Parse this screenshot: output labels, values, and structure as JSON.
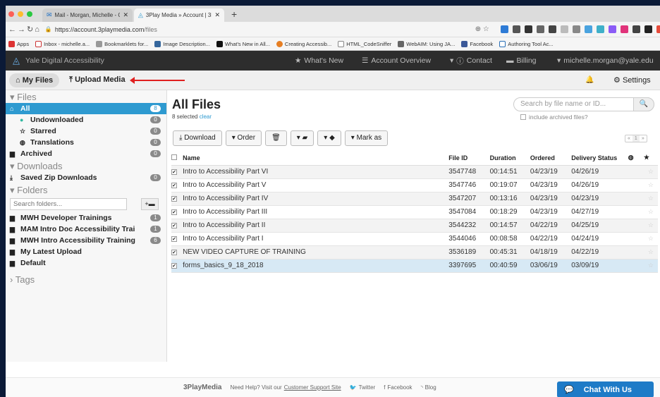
{
  "browser": {
    "tabs": [
      {
        "label": "Mail - Morgan, Michelle - Outlo",
        "icon": "outlook-icon"
      },
      {
        "label": "3Play Media » Account | 3Play",
        "icon": "3play-icon"
      }
    ],
    "new_tab": "+",
    "url_host": "https://account.3playmedia.com",
    "url_path": "/files",
    "bookmarks": [
      "Apps",
      "Inbox - michelle.a...",
      "Bookmarklets for...",
      "Image Description...",
      "What's New in All...",
      "Creating Accessib...",
      "HTML_CodeSniffer",
      "WebAIM: Using JA...",
      "Facebook",
      "Authoring Tool Ac..."
    ]
  },
  "app": {
    "brand": "Yale Digital Accessibility",
    "menu": {
      "whats_new": "What's New",
      "account_overview": "Account Overview",
      "contact": "Contact",
      "billing": "Billing",
      "user": "michelle.morgan@yale.edu"
    },
    "my_files": "My Files",
    "upload_media": "Upload Media",
    "settings": "Settings"
  },
  "sidebar": {
    "files_header": "Files",
    "all": {
      "label": "All",
      "count": "8"
    },
    "undownloaded": {
      "label": "Undownloaded",
      "count": "0"
    },
    "starred": {
      "label": "Starred",
      "count": "0"
    },
    "translations": {
      "label": "Translations",
      "count": "0"
    },
    "archived": {
      "label": "Archived",
      "count": "0"
    },
    "downloads_header": "Downloads",
    "saved_zip": {
      "label": "Saved Zip Downloads",
      "count": "0"
    },
    "folders_header": "Folders",
    "folder_search_placeholder": "Search folders...",
    "folders": [
      {
        "label": "MWH Developer Trainings",
        "count": "1"
      },
      {
        "label": "MAM Intro Doc Accessibility Trai",
        "count": "1"
      },
      {
        "label": "MWH Intro Accessibility Training",
        "count": "6"
      },
      {
        "label": "My Latest Upload",
        "count": ""
      },
      {
        "label": "Default",
        "count": ""
      }
    ],
    "tags_header": "Tags"
  },
  "main": {
    "title": "All Files",
    "selected_text": "8 selected",
    "clear": "clear",
    "search_placeholder": "Search by file name or ID...",
    "include_archived": "include archived files?",
    "toolbar": {
      "download": "Download",
      "order": "Order",
      "mark_as": "Mark as"
    },
    "pager": {
      "prev": "«",
      "page": "1",
      "next": "»"
    },
    "columns": {
      "name": "Name",
      "file_id": "File ID",
      "duration": "Duration",
      "ordered": "Ordered",
      "status": "Delivery Status"
    },
    "rows": [
      {
        "name": "Intro to Accessibility Part VI",
        "id": "3547748",
        "duration": "00:14:51",
        "ordered": "04/23/19",
        "status": "04/26/19"
      },
      {
        "name": "Intro to Accessibility Part V",
        "id": "3547746",
        "duration": "00:19:07",
        "ordered": "04/23/19",
        "status": "04/26/19"
      },
      {
        "name": "Intro to Accessibility Part IV",
        "id": "3547207",
        "duration": "00:13:16",
        "ordered": "04/23/19",
        "status": "04/23/19"
      },
      {
        "name": "Intro to Accessibility Part III",
        "id": "3547084",
        "duration": "00:18:29",
        "ordered": "04/23/19",
        "status": "04/27/19"
      },
      {
        "name": "Intro to Accessibility Part II",
        "id": "3544232",
        "duration": "00:14:57",
        "ordered": "04/22/19",
        "status": "04/25/19"
      },
      {
        "name": "Intro to Accessibility Part I",
        "id": "3544046",
        "duration": "00:08:58",
        "ordered": "04/22/19",
        "status": "04/24/19"
      },
      {
        "name": "NEW VIDEO CAPTURE OF TRAINING",
        "id": "3536189",
        "duration": "00:45:31",
        "ordered": "04/18/19",
        "status": "04/22/19"
      },
      {
        "name": "forms_basics_9_18_2018",
        "id": "3397695",
        "duration": "00:40:59",
        "ordered": "03/06/19",
        "status": "03/09/19"
      }
    ]
  },
  "footer": {
    "logo": "3PlayMedia",
    "help": "Need Help? Visit our",
    "support": "Customer Support Site",
    "twitter": "Twitter",
    "facebook": "Facebook",
    "blog": "Blog",
    "chat": "Chat With Us"
  },
  "colors": {
    "accent": "#2e9ad0",
    "header": "#2d2d2d",
    "chat": "#1e7bc7",
    "arrow": "#e02020"
  }
}
